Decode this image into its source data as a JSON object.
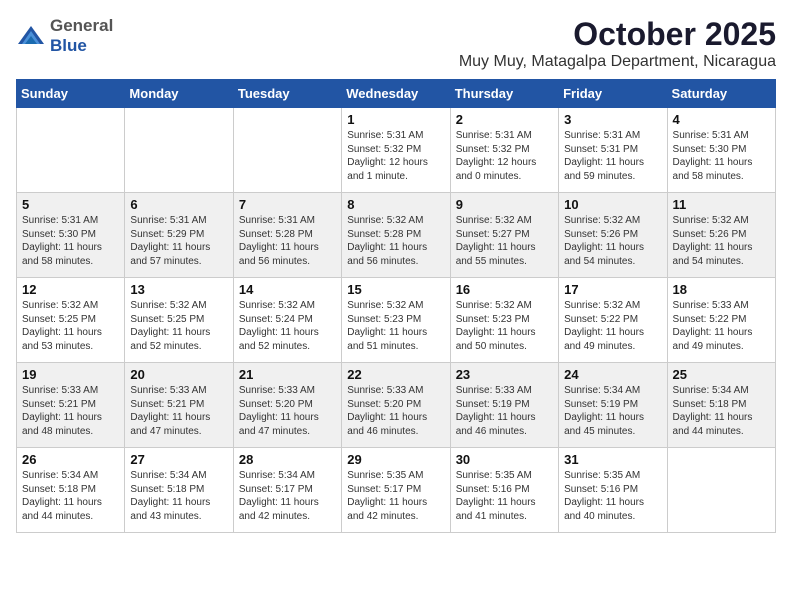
{
  "header": {
    "logo_general": "General",
    "logo_blue": "Blue",
    "month": "October 2025",
    "location": "Muy Muy, Matagalpa Department, Nicaragua"
  },
  "weekdays": [
    "Sunday",
    "Monday",
    "Tuesday",
    "Wednesday",
    "Thursday",
    "Friday",
    "Saturday"
  ],
  "weeks": [
    [
      {
        "day": "",
        "info": ""
      },
      {
        "day": "",
        "info": ""
      },
      {
        "day": "",
        "info": ""
      },
      {
        "day": "1",
        "info": "Sunrise: 5:31 AM\nSunset: 5:32 PM\nDaylight: 12 hours\nand 1 minute."
      },
      {
        "day": "2",
        "info": "Sunrise: 5:31 AM\nSunset: 5:32 PM\nDaylight: 12 hours\nand 0 minutes."
      },
      {
        "day": "3",
        "info": "Sunrise: 5:31 AM\nSunset: 5:31 PM\nDaylight: 11 hours\nand 59 minutes."
      },
      {
        "day": "4",
        "info": "Sunrise: 5:31 AM\nSunset: 5:30 PM\nDaylight: 11 hours\nand 58 minutes."
      }
    ],
    [
      {
        "day": "5",
        "info": "Sunrise: 5:31 AM\nSunset: 5:30 PM\nDaylight: 11 hours\nand 58 minutes."
      },
      {
        "day": "6",
        "info": "Sunrise: 5:31 AM\nSunset: 5:29 PM\nDaylight: 11 hours\nand 57 minutes."
      },
      {
        "day": "7",
        "info": "Sunrise: 5:31 AM\nSunset: 5:28 PM\nDaylight: 11 hours\nand 56 minutes."
      },
      {
        "day": "8",
        "info": "Sunrise: 5:32 AM\nSunset: 5:28 PM\nDaylight: 11 hours\nand 56 minutes."
      },
      {
        "day": "9",
        "info": "Sunrise: 5:32 AM\nSunset: 5:27 PM\nDaylight: 11 hours\nand 55 minutes."
      },
      {
        "day": "10",
        "info": "Sunrise: 5:32 AM\nSunset: 5:26 PM\nDaylight: 11 hours\nand 54 minutes."
      },
      {
        "day": "11",
        "info": "Sunrise: 5:32 AM\nSunset: 5:26 PM\nDaylight: 11 hours\nand 54 minutes."
      }
    ],
    [
      {
        "day": "12",
        "info": "Sunrise: 5:32 AM\nSunset: 5:25 PM\nDaylight: 11 hours\nand 53 minutes."
      },
      {
        "day": "13",
        "info": "Sunrise: 5:32 AM\nSunset: 5:25 PM\nDaylight: 11 hours\nand 52 minutes."
      },
      {
        "day": "14",
        "info": "Sunrise: 5:32 AM\nSunset: 5:24 PM\nDaylight: 11 hours\nand 52 minutes."
      },
      {
        "day": "15",
        "info": "Sunrise: 5:32 AM\nSunset: 5:23 PM\nDaylight: 11 hours\nand 51 minutes."
      },
      {
        "day": "16",
        "info": "Sunrise: 5:32 AM\nSunset: 5:23 PM\nDaylight: 11 hours\nand 50 minutes."
      },
      {
        "day": "17",
        "info": "Sunrise: 5:32 AM\nSunset: 5:22 PM\nDaylight: 11 hours\nand 49 minutes."
      },
      {
        "day": "18",
        "info": "Sunrise: 5:33 AM\nSunset: 5:22 PM\nDaylight: 11 hours\nand 49 minutes."
      }
    ],
    [
      {
        "day": "19",
        "info": "Sunrise: 5:33 AM\nSunset: 5:21 PM\nDaylight: 11 hours\nand 48 minutes."
      },
      {
        "day": "20",
        "info": "Sunrise: 5:33 AM\nSunset: 5:21 PM\nDaylight: 11 hours\nand 47 minutes."
      },
      {
        "day": "21",
        "info": "Sunrise: 5:33 AM\nSunset: 5:20 PM\nDaylight: 11 hours\nand 47 minutes."
      },
      {
        "day": "22",
        "info": "Sunrise: 5:33 AM\nSunset: 5:20 PM\nDaylight: 11 hours\nand 46 minutes."
      },
      {
        "day": "23",
        "info": "Sunrise: 5:33 AM\nSunset: 5:19 PM\nDaylight: 11 hours\nand 46 minutes."
      },
      {
        "day": "24",
        "info": "Sunrise: 5:34 AM\nSunset: 5:19 PM\nDaylight: 11 hours\nand 45 minutes."
      },
      {
        "day": "25",
        "info": "Sunrise: 5:34 AM\nSunset: 5:18 PM\nDaylight: 11 hours\nand 44 minutes."
      }
    ],
    [
      {
        "day": "26",
        "info": "Sunrise: 5:34 AM\nSunset: 5:18 PM\nDaylight: 11 hours\nand 44 minutes."
      },
      {
        "day": "27",
        "info": "Sunrise: 5:34 AM\nSunset: 5:18 PM\nDaylight: 11 hours\nand 43 minutes."
      },
      {
        "day": "28",
        "info": "Sunrise: 5:34 AM\nSunset: 5:17 PM\nDaylight: 11 hours\nand 42 minutes."
      },
      {
        "day": "29",
        "info": "Sunrise: 5:35 AM\nSunset: 5:17 PM\nDaylight: 11 hours\nand 42 minutes."
      },
      {
        "day": "30",
        "info": "Sunrise: 5:35 AM\nSunset: 5:16 PM\nDaylight: 11 hours\nand 41 minutes."
      },
      {
        "day": "31",
        "info": "Sunrise: 5:35 AM\nSunset: 5:16 PM\nDaylight: 11 hours\nand 40 minutes."
      },
      {
        "day": "",
        "info": ""
      }
    ]
  ]
}
